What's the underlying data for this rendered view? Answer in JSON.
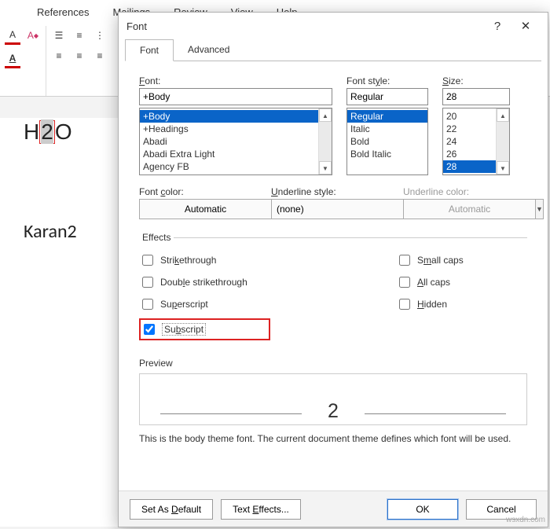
{
  "ribbon": {
    "tabs": [
      "References",
      "Mailings",
      "Review",
      "View",
      "Help"
    ]
  },
  "doc": {
    "line1_a": "H",
    "line1_sel": "2",
    "line1_b": "O",
    "line2": "Karan2"
  },
  "dialog": {
    "title": "Font",
    "help": "?",
    "close": "✕",
    "tabs": {
      "font": "Font",
      "advanced": "Advanced"
    },
    "labels": {
      "font": "Font:",
      "font_u": "F",
      "style": "Font style:",
      "style_u": "y",
      "size": "Size:",
      "color": "Font color:",
      "ulstyle": "Underline style:",
      "ulcolor": "Underline color:",
      "effects": "Effects",
      "preview": "Preview"
    },
    "font_value": "+Body",
    "fonts": [
      "+Body",
      "+Headings",
      "Abadi",
      "Abadi Extra Light",
      "Agency FB"
    ],
    "style_value": "Regular",
    "styles": [
      "Regular",
      "Italic",
      "Bold",
      "Bold Italic"
    ],
    "size_value": "28",
    "sizes": [
      "20",
      "22",
      "24",
      "26",
      "28"
    ],
    "color_value": "Automatic",
    "ulstyle_value": "(none)",
    "ulcolor_value": "Automatic",
    "fx": {
      "strike": "Strikethrough",
      "dstrike": "Double strikethrough",
      "super": "Superscript",
      "sub": "Subscript",
      "smallcaps": "Small caps",
      "allcaps": "All caps",
      "hidden": "Hidden"
    },
    "preview_char": "2",
    "preview_note": "This is the body theme font. The current document theme defines which font will be used.",
    "bottom": {
      "default": "Set As Default",
      "texteff": "Text Effects...",
      "ok": "OK",
      "cancel": "Cancel"
    }
  },
  "watermark": "wsxdn.com"
}
